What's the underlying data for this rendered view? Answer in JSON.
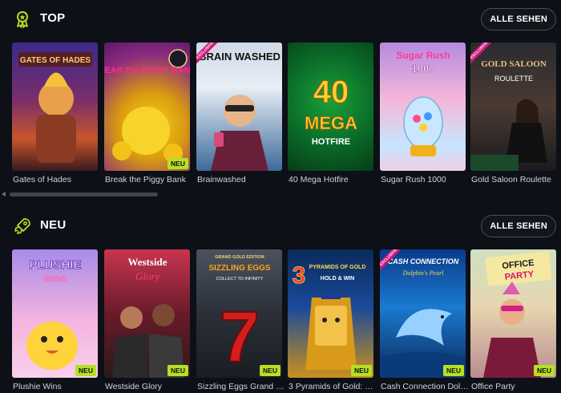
{
  "sections": {
    "top": {
      "title": "TOP",
      "see_all": "ALLE SEHEN",
      "icon": "award-ribbon-icon",
      "games": [
        {
          "name": "Gates of Hades",
          "art_text": "GATES OF HADES"
        },
        {
          "name": "Break the Piggy Bank",
          "art_text": "BREAK the PIGGY BANK",
          "badge": "NEU"
        },
        {
          "name": "Brainwashed",
          "art_text": "BRAIN WASHED",
          "ribbon": "EXCLUSIVE"
        },
        {
          "name": "40 Mega Hotfire",
          "art_text_1": "40",
          "art_text_2": "MEGA",
          "art_text_3": "HOTFIRE"
        },
        {
          "name": "Sugar Rush 1000",
          "art_text_1": "Sugar Rush",
          "art_text_2": "1000"
        },
        {
          "name": "Gold Saloon Roulette",
          "art_text_1": "GOLD SALOON",
          "art_text_2": "ROULETTE",
          "ribbon": "EXCLUSIVE"
        }
      ]
    },
    "neu": {
      "title": "NEU",
      "see_all": "ALLE SEHEN",
      "icon": "rocket-icon",
      "games": [
        {
          "name": "Plushie Wins",
          "art_text_1": "PLUSHIE",
          "art_text_2": "WINS",
          "badge": "NEU"
        },
        {
          "name": "Westside Glory",
          "art_text_1": "Westside",
          "art_text_2": "Glory",
          "badge": "NEU"
        },
        {
          "name": "Sizzling Eggs Grand G...",
          "art_text_1": "GRAND GOLD EDITION",
          "art_text_2": "SIZZLING EGGS",
          "art_text_3": "COLLECT TO INFINITY",
          "badge": "NEU"
        },
        {
          "name": "3 Pyramids of Gold: Hol...",
          "art_text_1": "3",
          "art_text_2": "PYRAMIDS OF GOLD",
          "art_text_3": "HOLD & WIN",
          "badge": "NEU"
        },
        {
          "name": "Cash Connection Dolp...",
          "art_text_1": "CASH CONNECTION",
          "art_text_2": "Dolphin's Pearl",
          "badge": "NEU",
          "ribbon": "EXCLUSIVE"
        },
        {
          "name": "Office Party",
          "art_text_1": "OFFICE",
          "art_text_2": "PARTY",
          "badge": "NEU"
        }
      ]
    }
  },
  "colors": {
    "accent": "#b6e023",
    "background": "#0d1016",
    "ribbon": "#d1147a"
  }
}
